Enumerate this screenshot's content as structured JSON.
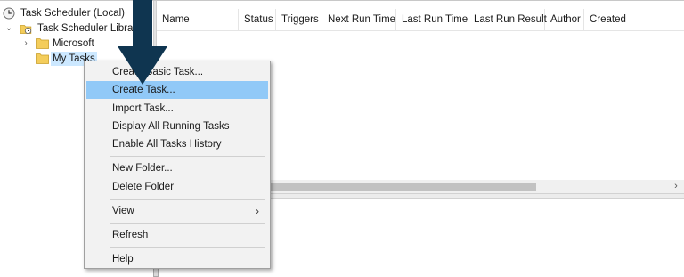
{
  "tree": {
    "root_label": "Task Scheduler (Local)",
    "library_label": "Task Scheduler Library",
    "folders": [
      {
        "label": "Microsoft",
        "selected": false
      },
      {
        "label": "My Tasks",
        "selected": true
      }
    ]
  },
  "columns": [
    "Name",
    "Status",
    "Triggers",
    "Next Run Time",
    "Last Run Time",
    "Last Run Result",
    "Author",
    "Created"
  ],
  "context_menu": {
    "items": [
      {
        "label": "Create Basic Task...",
        "highlighted": false
      },
      {
        "label": "Create Task...",
        "highlighted": true
      },
      {
        "label": "Import Task...",
        "highlighted": false
      },
      {
        "label": "Display All Running Tasks",
        "highlighted": false
      },
      {
        "label": "Enable All Tasks History",
        "highlighted": false
      },
      {
        "label": "New Folder...",
        "highlighted": false
      },
      {
        "label": "Delete Folder",
        "highlighted": false
      },
      {
        "label": "View",
        "highlighted": false,
        "submenu": true
      },
      {
        "label": "Refresh",
        "highlighted": false
      },
      {
        "label": "Help",
        "highlighted": false
      }
    ],
    "submenu_glyph": "›"
  },
  "scroll_right_glyph": "›",
  "colors": {
    "menu_highlight": "#91c9f7",
    "selection": "#cce8ff",
    "arrow": "#0f3550",
    "folder": "#f4cd5b"
  },
  "icons": {
    "root": "clock-icon",
    "library": "task-library-icon",
    "folder": "folder-icon",
    "pointer": "down-arrow-icon"
  }
}
